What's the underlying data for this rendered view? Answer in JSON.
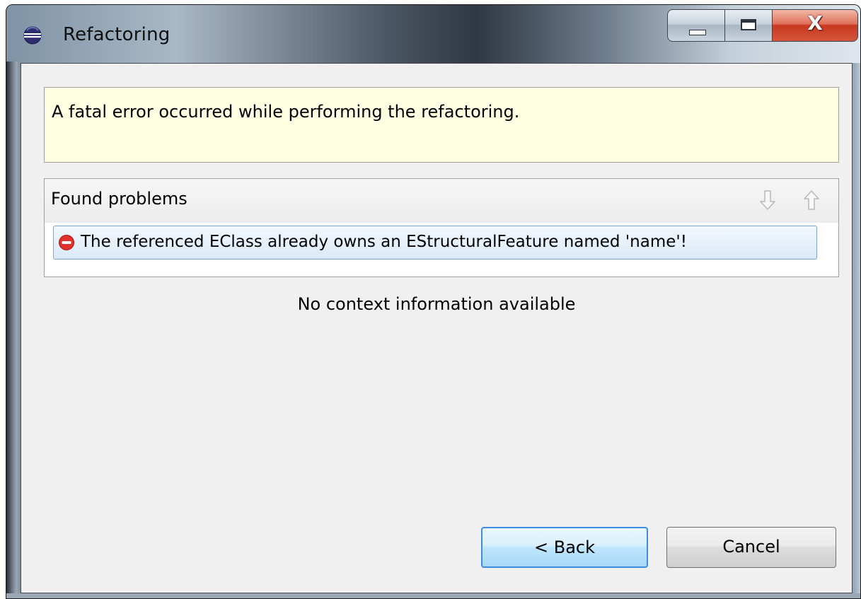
{
  "window": {
    "title": "Refactoring",
    "controls": {
      "minimize_icon": "minimize-icon",
      "maximize_icon": "maximize-icon",
      "close_label": "X"
    }
  },
  "message": {
    "text": "A fatal error occurred while performing the refactoring."
  },
  "problems": {
    "title": "Found problems",
    "nav": {
      "next_icon": "arrow-down-icon",
      "previous_icon": "arrow-up-icon"
    },
    "items": [
      {
        "severity": "error",
        "icon": "error-icon",
        "text": "The referenced EClass already owns an EStructuralFeature named 'name'!"
      }
    ]
  },
  "context": {
    "text": "No context information available"
  },
  "buttons": {
    "back_label": "< Back",
    "cancel_label": "Cancel"
  },
  "colors": {
    "message_background": "#ffffe1",
    "selection_background": "#dbe9f7",
    "error_red": "#e0312e",
    "default_button_border": "#3d8ee0"
  }
}
